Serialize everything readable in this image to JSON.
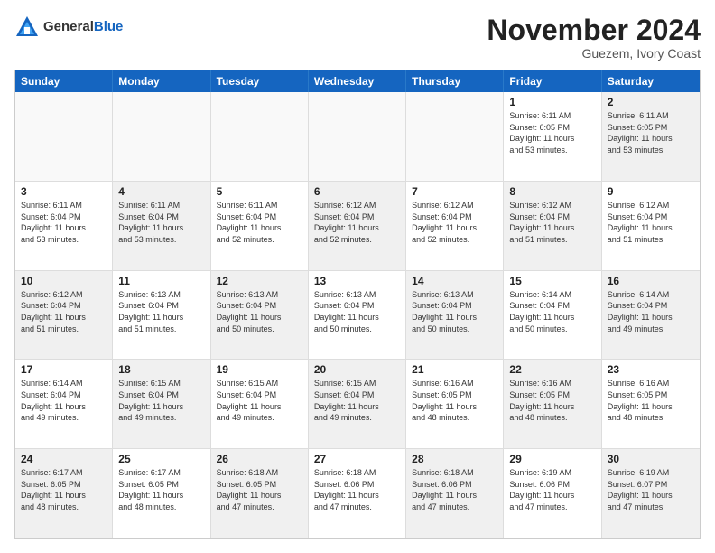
{
  "logo": {
    "general": "General",
    "blue": "Blue"
  },
  "header": {
    "title": "November 2024",
    "subtitle": "Guezem, Ivory Coast"
  },
  "days": [
    "Sunday",
    "Monday",
    "Tuesday",
    "Wednesday",
    "Thursday",
    "Friday",
    "Saturday"
  ],
  "rows": [
    [
      {
        "day": "",
        "info": "",
        "empty": true
      },
      {
        "day": "",
        "info": "",
        "empty": true
      },
      {
        "day": "",
        "info": "",
        "empty": true
      },
      {
        "day": "",
        "info": "",
        "empty": true
      },
      {
        "day": "",
        "info": "",
        "empty": true
      },
      {
        "day": "1",
        "info": "Sunrise: 6:11 AM\nSunset: 6:05 PM\nDaylight: 11 hours\nand 53 minutes.",
        "empty": false
      },
      {
        "day": "2",
        "info": "Sunrise: 6:11 AM\nSunset: 6:05 PM\nDaylight: 11 hours\nand 53 minutes.",
        "empty": false,
        "shaded": true
      }
    ],
    [
      {
        "day": "3",
        "info": "Sunrise: 6:11 AM\nSunset: 6:04 PM\nDaylight: 11 hours\nand 53 minutes.",
        "empty": false
      },
      {
        "day": "4",
        "info": "Sunrise: 6:11 AM\nSunset: 6:04 PM\nDaylight: 11 hours\nand 53 minutes.",
        "empty": false,
        "shaded": true
      },
      {
        "day": "5",
        "info": "Sunrise: 6:11 AM\nSunset: 6:04 PM\nDaylight: 11 hours\nand 52 minutes.",
        "empty": false
      },
      {
        "day": "6",
        "info": "Sunrise: 6:12 AM\nSunset: 6:04 PM\nDaylight: 11 hours\nand 52 minutes.",
        "empty": false,
        "shaded": true
      },
      {
        "day": "7",
        "info": "Sunrise: 6:12 AM\nSunset: 6:04 PM\nDaylight: 11 hours\nand 52 minutes.",
        "empty": false
      },
      {
        "day": "8",
        "info": "Sunrise: 6:12 AM\nSunset: 6:04 PM\nDaylight: 11 hours\nand 51 minutes.",
        "empty": false,
        "shaded": true
      },
      {
        "day": "9",
        "info": "Sunrise: 6:12 AM\nSunset: 6:04 PM\nDaylight: 11 hours\nand 51 minutes.",
        "empty": false
      }
    ],
    [
      {
        "day": "10",
        "info": "Sunrise: 6:12 AM\nSunset: 6:04 PM\nDaylight: 11 hours\nand 51 minutes.",
        "empty": false,
        "shaded": true
      },
      {
        "day": "11",
        "info": "Sunrise: 6:13 AM\nSunset: 6:04 PM\nDaylight: 11 hours\nand 51 minutes.",
        "empty": false
      },
      {
        "day": "12",
        "info": "Sunrise: 6:13 AM\nSunset: 6:04 PM\nDaylight: 11 hours\nand 50 minutes.",
        "empty": false,
        "shaded": true
      },
      {
        "day": "13",
        "info": "Sunrise: 6:13 AM\nSunset: 6:04 PM\nDaylight: 11 hours\nand 50 minutes.",
        "empty": false
      },
      {
        "day": "14",
        "info": "Sunrise: 6:13 AM\nSunset: 6:04 PM\nDaylight: 11 hours\nand 50 minutes.",
        "empty": false,
        "shaded": true
      },
      {
        "day": "15",
        "info": "Sunrise: 6:14 AM\nSunset: 6:04 PM\nDaylight: 11 hours\nand 50 minutes.",
        "empty": false
      },
      {
        "day": "16",
        "info": "Sunrise: 6:14 AM\nSunset: 6:04 PM\nDaylight: 11 hours\nand 49 minutes.",
        "empty": false,
        "shaded": true
      }
    ],
    [
      {
        "day": "17",
        "info": "Sunrise: 6:14 AM\nSunset: 6:04 PM\nDaylight: 11 hours\nand 49 minutes.",
        "empty": false
      },
      {
        "day": "18",
        "info": "Sunrise: 6:15 AM\nSunset: 6:04 PM\nDaylight: 11 hours\nand 49 minutes.",
        "empty": false,
        "shaded": true
      },
      {
        "day": "19",
        "info": "Sunrise: 6:15 AM\nSunset: 6:04 PM\nDaylight: 11 hours\nand 49 minutes.",
        "empty": false
      },
      {
        "day": "20",
        "info": "Sunrise: 6:15 AM\nSunset: 6:04 PM\nDaylight: 11 hours\nand 49 minutes.",
        "empty": false,
        "shaded": true
      },
      {
        "day": "21",
        "info": "Sunrise: 6:16 AM\nSunset: 6:05 PM\nDaylight: 11 hours\nand 48 minutes.",
        "empty": false
      },
      {
        "day": "22",
        "info": "Sunrise: 6:16 AM\nSunset: 6:05 PM\nDaylight: 11 hours\nand 48 minutes.",
        "empty": false,
        "shaded": true
      },
      {
        "day": "23",
        "info": "Sunrise: 6:16 AM\nSunset: 6:05 PM\nDaylight: 11 hours\nand 48 minutes.",
        "empty": false
      }
    ],
    [
      {
        "day": "24",
        "info": "Sunrise: 6:17 AM\nSunset: 6:05 PM\nDaylight: 11 hours\nand 48 minutes.",
        "empty": false,
        "shaded": true
      },
      {
        "day": "25",
        "info": "Sunrise: 6:17 AM\nSunset: 6:05 PM\nDaylight: 11 hours\nand 48 minutes.",
        "empty": false
      },
      {
        "day": "26",
        "info": "Sunrise: 6:18 AM\nSunset: 6:05 PM\nDaylight: 11 hours\nand 47 minutes.",
        "empty": false,
        "shaded": true
      },
      {
        "day": "27",
        "info": "Sunrise: 6:18 AM\nSunset: 6:06 PM\nDaylight: 11 hours\nand 47 minutes.",
        "empty": false
      },
      {
        "day": "28",
        "info": "Sunrise: 6:18 AM\nSunset: 6:06 PM\nDaylight: 11 hours\nand 47 minutes.",
        "empty": false,
        "shaded": true
      },
      {
        "day": "29",
        "info": "Sunrise: 6:19 AM\nSunset: 6:06 PM\nDaylight: 11 hours\nand 47 minutes.",
        "empty": false
      },
      {
        "day": "30",
        "info": "Sunrise: 6:19 AM\nSunset: 6:07 PM\nDaylight: 11 hours\nand 47 minutes.",
        "empty": false,
        "shaded": true
      }
    ]
  ]
}
